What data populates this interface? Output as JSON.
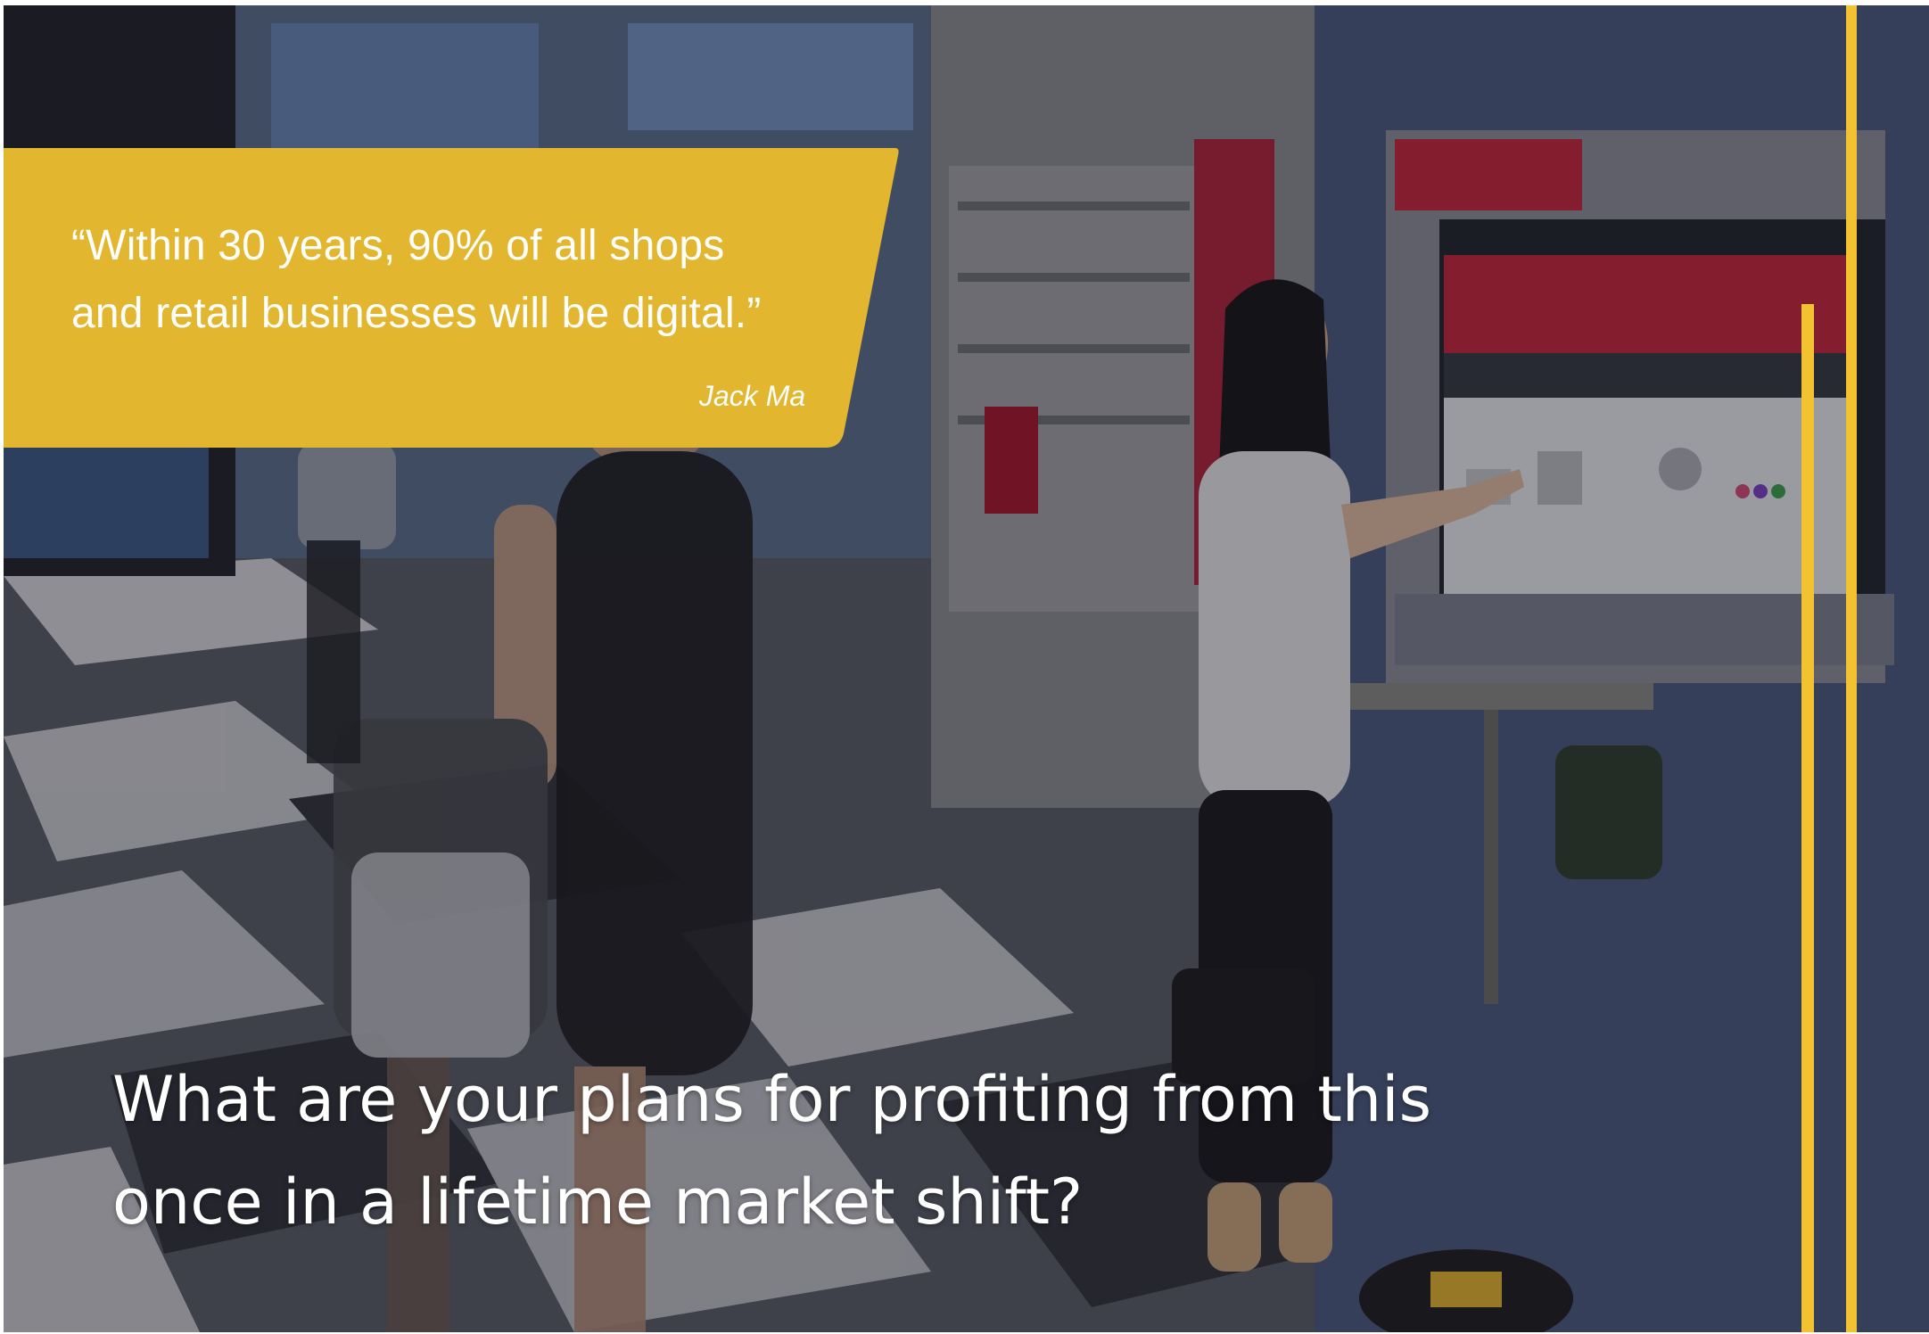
{
  "quote": {
    "line1": "“Within 30 years, 90% of all shops",
    "line2": "and retail businesses will be digital.”",
    "author": "Jack Ma"
  },
  "headline": {
    "line1": "What are your plans for profiting from this",
    "line2": "once in a lifetime market shift?"
  },
  "colors": {
    "banner_gold": "#e2b72f",
    "accent_yellow": "#f2c230",
    "screen_red": "#c8243a"
  }
}
